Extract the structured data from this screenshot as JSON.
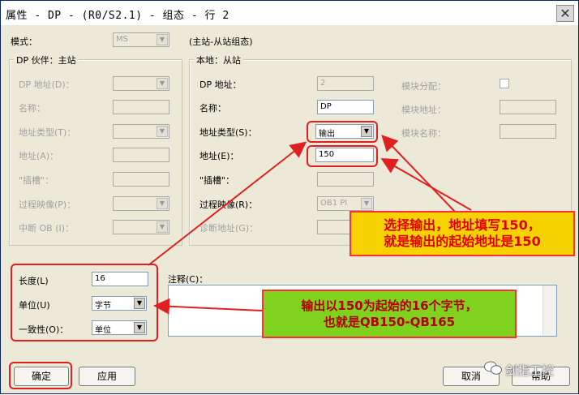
{
  "window": {
    "title": "属性 - DP - (R0/S2.1) - 组态 - 行 2",
    "close_glyph": "✕"
  },
  "mode": {
    "label": "模式：",
    "value": "MS",
    "caption": "(主站-从站组态)"
  },
  "partner": {
    "group_title": "DP 伙伴：主站",
    "dp_address_label": "DP 地址(D)：",
    "name_label": "名称：",
    "address_type_label": "地址类型(T)：",
    "address_label": "地址(A)：",
    "slot_label": "\"插槽\"：",
    "process_image_label": "过程映像(P)：",
    "interrupt_ob_label": "中断 OB (I)："
  },
  "local": {
    "group_title": "本地：从站",
    "dp_address_label": "DP 地址：",
    "dp_address_value": "2",
    "name_label": "名称：",
    "name_value": "DP",
    "address_type_label": "地址类型(S)：",
    "address_type_value": "输出",
    "address_label": "地址(E)：",
    "address_value": "150",
    "slot_label": "\"插槽\"：",
    "process_image_label": "过程映像(R)：",
    "process_image_value": "OB1 PI",
    "diag_address_label": "诊断地址(G)：",
    "module_assign_label": "模块分配：",
    "module_address_label": "模块地址：",
    "module_name_label": "模块名称："
  },
  "length": {
    "label": "长度(L)",
    "value": "16"
  },
  "unit": {
    "label": "单位(U)",
    "value": "字节"
  },
  "consistency": {
    "label": "一致性(O)：",
    "value": "单位"
  },
  "comment": {
    "label": "注释(C)："
  },
  "buttons": {
    "ok": "确定",
    "apply": "应用",
    "cancel": "取消",
    "help": "帮助"
  },
  "annotations": {
    "top_line1": "选择输出，地址填写150，",
    "top_line2": "就是输出的起始地址是150",
    "bottom_line1": "输出以150为起始的16个字节，",
    "bottom_line2": "也就是QB150-QB165"
  },
  "watermark": "剑指工控",
  "colors": {
    "highlight_red": "#e02020",
    "callout_yellow": "#f6d200",
    "callout_green": "#7fd21e"
  }
}
